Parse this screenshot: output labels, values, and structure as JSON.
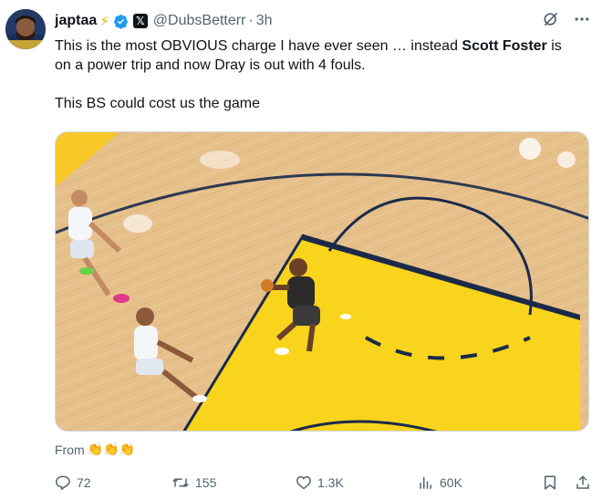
{
  "post": {
    "author_name": "japtaa",
    "author_emoji": "⚡",
    "handle": "@DubsBetterr",
    "separator": "·",
    "time": "3h",
    "text_line1_a": "This is the most OBVIOUS charge I have ever seen … instead ",
    "text_line1_b": "Scott Foster",
    "text_line1_c": " is",
    "text_line2": "on a power trip and now Dray is out with 4 fouls.",
    "text_line3": "This BS could cost us the game",
    "from_label": "From",
    "from_emojis": "👏👏👏"
  },
  "metrics": {
    "replies": "72",
    "reposts": "155",
    "likes": "1.3K",
    "views": "60K"
  },
  "colors": {
    "text": "#0f1419",
    "secondary": "#536471",
    "verified": "#1d9bf0",
    "court_wood": "#e9c592",
    "paint_yellow": "#f9d81f"
  },
  "icons": {
    "verified": "verified-badge-icon",
    "grok": "grok-icon",
    "more": "more-icon",
    "reply": "reply-icon",
    "repost": "repost-icon",
    "like": "like-icon",
    "views": "views-icon",
    "bookmark": "bookmark-icon",
    "share": "share-icon"
  }
}
